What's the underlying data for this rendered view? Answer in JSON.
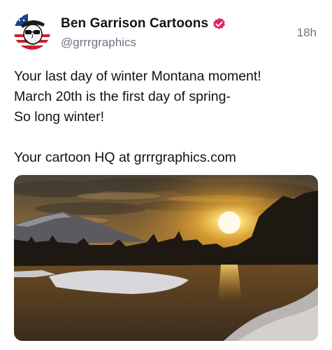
{
  "post": {
    "author": {
      "display_name": "Ben Garrison Cartoons",
      "handle": "@grrrgraphics",
      "verified": true
    },
    "timestamp": "18h",
    "text_lines": [
      "Your last day of winter Montana moment!",
      "March 20th is the first day of spring-",
      "So long winter!",
      "",
      "Your cartoon HQ at grrrgraphics.com"
    ],
    "media": {
      "type": "photo"
    }
  },
  "colors": {
    "verified_badge": "#e0245e",
    "handle_gray": "#6b7480",
    "text": "#0f1419"
  },
  "icons": {
    "verified": "verified-badge-icon",
    "avatar": "cartoon-avatar-icon"
  }
}
